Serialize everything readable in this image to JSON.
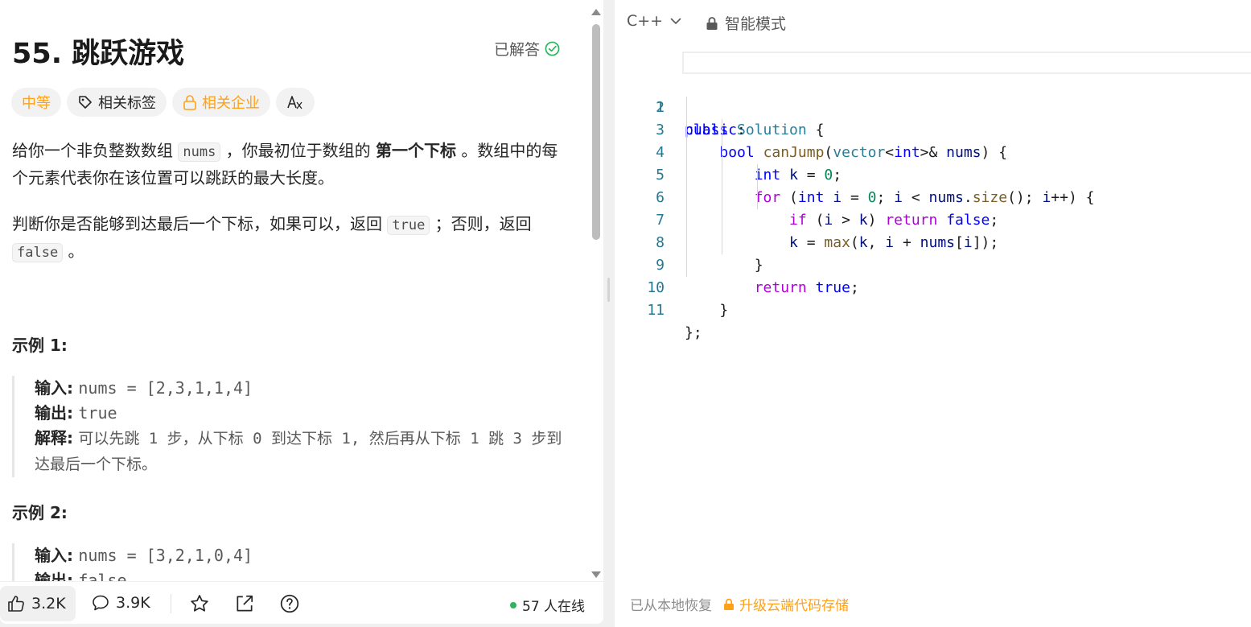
{
  "problem": {
    "title": "55. 跳跃游戏",
    "solved_label": "已解答",
    "tags": {
      "difficulty": "中等",
      "related_tags": "相关标签",
      "related_companies": "相关企业"
    },
    "desc": {
      "p1_a": "给你一个非负整数数组",
      "p1_code": "nums",
      "p1_b": "，你最初位于数组的",
      "p1_bold": "第一个下标",
      "p1_c": "。数组中的每个元素代表你在该位置可以跳跃的最大长度。",
      "p2_a": "判断你是否能够到达最后一个下标，如果可以，返回",
      "p2_code1": "true",
      "p2_b": "；否则，返回",
      "p2_code2": "false",
      "p2_c": "。"
    },
    "examples": [
      {
        "title": "示例 1:",
        "input_label": "输入:",
        "input": "nums = [2,3,1,1,4]",
        "output_label": "输出:",
        "output": "true",
        "explain_label": "解释:",
        "explain": "可以先跳 1 步，从下标 0 到达下标 1, 然后再从下标 1 跳 3 步到达最后一个下标。"
      },
      {
        "title": "示例 2:",
        "input_label": "输入:",
        "input": "nums = [3,2,1,0,4]",
        "output_label": "输出:",
        "output": "false"
      }
    ]
  },
  "bottom_bar": {
    "likes": "3.2K",
    "comments": "3.9K",
    "online": "57 人在线"
  },
  "editor": {
    "language": "C++",
    "mode": "智能模式",
    "line_numbers": [
      "1",
      "2",
      "3",
      "4",
      "5",
      "6",
      "7",
      "8",
      "9",
      "10",
      "11"
    ],
    "restore_text": "已从本地恢复",
    "upgrade_text": "升级云端代码存储"
  },
  "colors": {
    "accent_orange": "#ffa116",
    "success_green": "#2db55d"
  }
}
